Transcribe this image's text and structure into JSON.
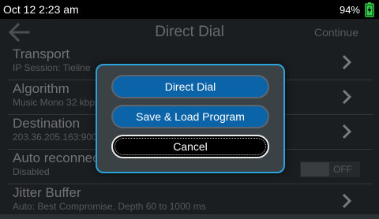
{
  "status": {
    "time": "Oct 12 2:23 am",
    "battery": "94%"
  },
  "header": {
    "title": "Direct Dial",
    "continue_label": "Continue"
  },
  "settings": [
    {
      "label": "Transport",
      "sub": "IP Session: Tieline"
    },
    {
      "label": "Algorithm",
      "sub": "Music Mono 32 kbps"
    },
    {
      "label": "Destination",
      "sub": "203.36.205.163:9002"
    },
    {
      "label": "Auto reconnect",
      "sub": "Disabled",
      "toggle": "OFF"
    },
    {
      "label": "Jitter Buffer",
      "sub": "Auto: Best Compromise,  Depth 60 to 1000 ms"
    }
  ],
  "dialog": {
    "direct_dial": "Direct Dial",
    "save_load": "Save & Load Program",
    "cancel": "Cancel"
  },
  "colors": {
    "accent": "#2aa2dc",
    "button_blue": "#0b64a8",
    "battery_green": "#35d44a"
  }
}
